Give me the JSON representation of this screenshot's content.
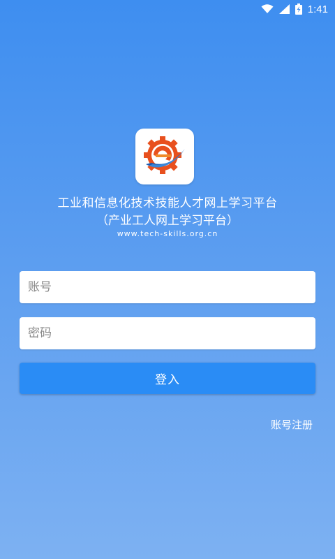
{
  "status_bar": {
    "time": "1:41",
    "icons": [
      "wifi-icon",
      "cell-signal-icon",
      "battery-charging-icon"
    ]
  },
  "logo": {
    "icon": "gear-e-logo-icon",
    "colors": {
      "gear": "#e8501e",
      "swoosh": "#1a5bb3",
      "accent": "#f08a2a"
    }
  },
  "title": "工业和信息化技术技能人才网上学习平台",
  "subtitle": "（产业工人网上学习平台）",
  "url": "www.tech-skills.org.cn",
  "form": {
    "account_placeholder": "账号",
    "password_placeholder": "密码",
    "login_label": "登入"
  },
  "register_label": "账号注册",
  "colors": {
    "background_top": "#3e8ef0",
    "background_bottom": "#7db1f2",
    "button": "#2a8cf5"
  }
}
